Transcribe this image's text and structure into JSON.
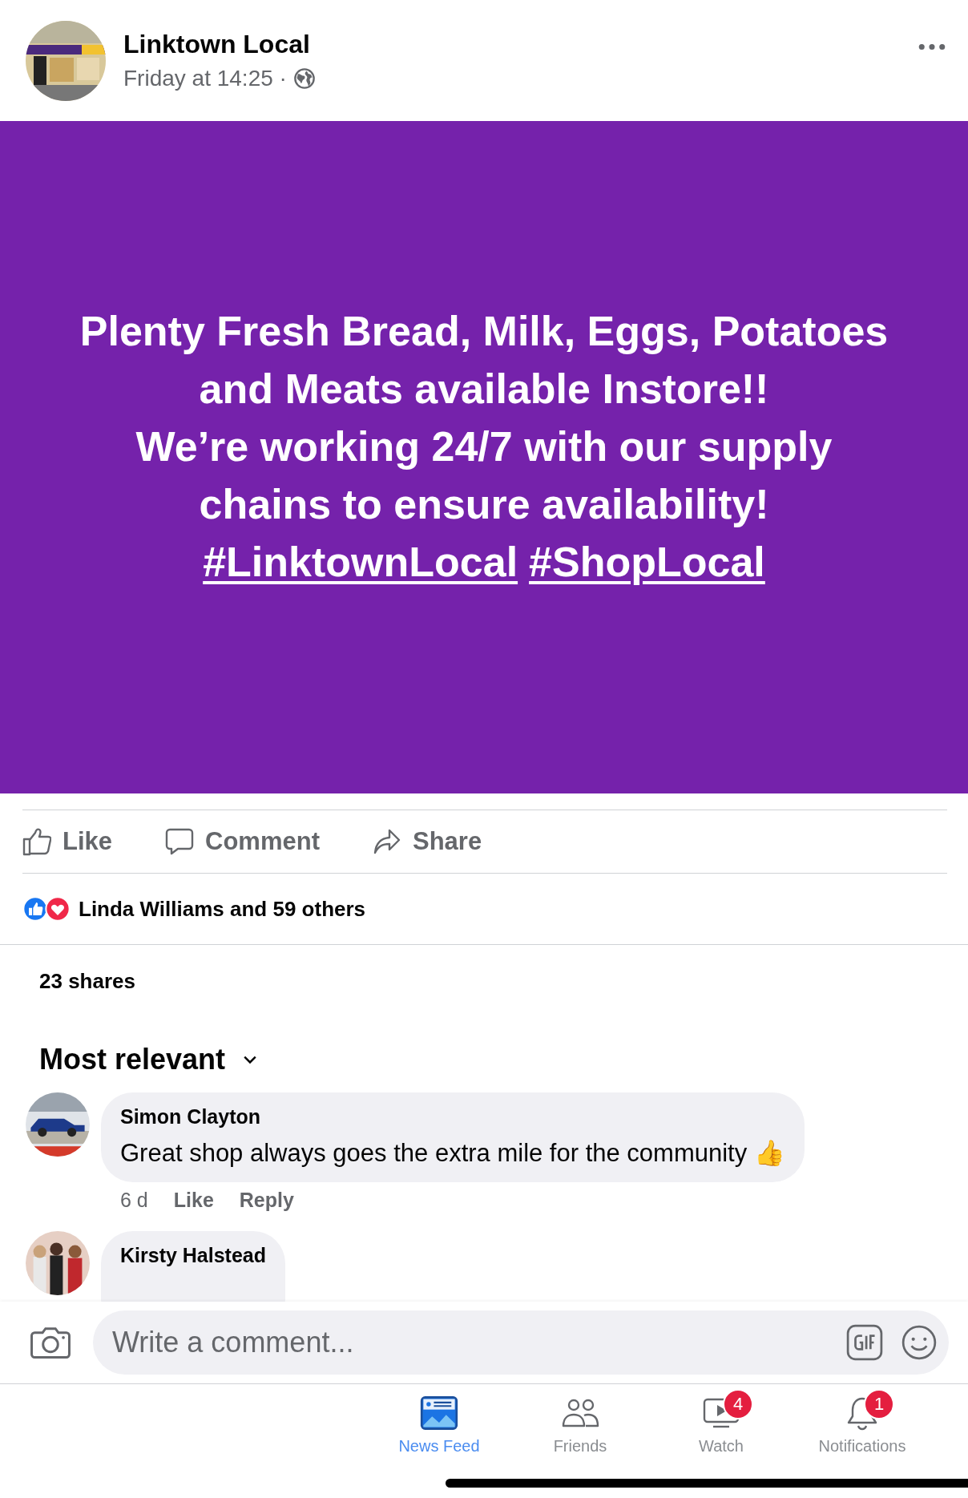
{
  "post": {
    "author": "Linktown Local",
    "time": "Friday at 14:25 ·",
    "paragraphs": [
      "Plenty Fresh Bread, Milk, Eggs, Potatoes and Meats available Instore!!",
      "We’re working 24/7 with our supply chains to ensure availability!"
    ],
    "hashtags": [
      "#LinktownLocal",
      "#ShopLocal"
    ]
  },
  "actions": [
    {
      "kind": "like",
      "label": "Like"
    },
    {
      "kind": "comment",
      "label": "Comment"
    },
    {
      "kind": "share",
      "label": "Share"
    }
  ],
  "reactions": "Linda Williams and 59 others",
  "shares": "23 shares",
  "sort": "Most relevant",
  "comments": [
    {
      "kind": "car",
      "name": "Simon Clayton",
      "text": "Great shop always goes the extra mile for the community 👍",
      "time": "6 d",
      "links": [
        "Like",
        "Reply"
      ]
    },
    {
      "kind": "people",
      "name": "Kirsty Halstead"
    }
  ],
  "composer": {
    "placeholder": "Write a comment..."
  },
  "tabs": [
    {
      "kind": "feed",
      "label": "News Feed",
      "selected": true
    },
    {
      "kind": "friends",
      "label": "Friends",
      "selected": false
    },
    {
      "kind": "watch",
      "label": "Watch",
      "selected": false,
      "badge": "4"
    },
    {
      "kind": "bell",
      "label": "Notifications",
      "selected": false,
      "badge": "1"
    }
  ]
}
